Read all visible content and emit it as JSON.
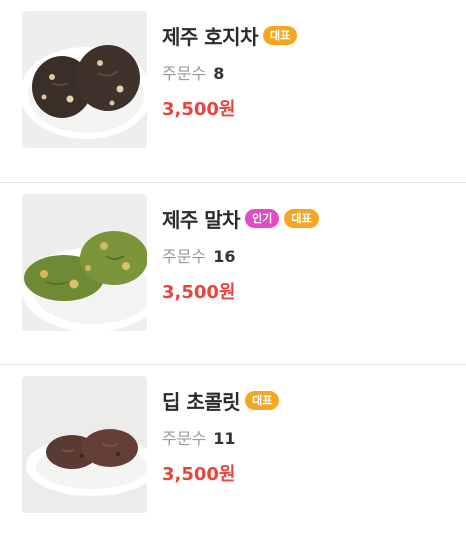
{
  "menu": {
    "items": [
      {
        "name": "제주 호지차",
        "badges": [
          {
            "label": "대표",
            "type": "rep",
            "color": "#f5a623"
          }
        ],
        "orders_label": "주문수",
        "orders_count": "8",
        "price": "3,500원",
        "image_icon": "hojicha-cookie-image"
      },
      {
        "name": "제주 말차",
        "badges": [
          {
            "label": "인기",
            "type": "pop",
            "color": "#e24bc7"
          },
          {
            "label": "대표",
            "type": "rep",
            "color": "#f5a623"
          }
        ],
        "orders_label": "주문수",
        "orders_count": "16",
        "price": "3,500원",
        "image_icon": "matcha-cookie-image"
      },
      {
        "name": "딥 초콜릿",
        "badges": [
          {
            "label": "대표",
            "type": "rep",
            "color": "#f5a623"
          }
        ],
        "orders_label": "주문수",
        "orders_count": "11",
        "price": "3,500원",
        "image_icon": "chocolate-cookie-image"
      }
    ]
  },
  "colors": {
    "price": "#e8453c",
    "badge_rep": "#f5a623",
    "badge_pop": "#e24bc7"
  }
}
